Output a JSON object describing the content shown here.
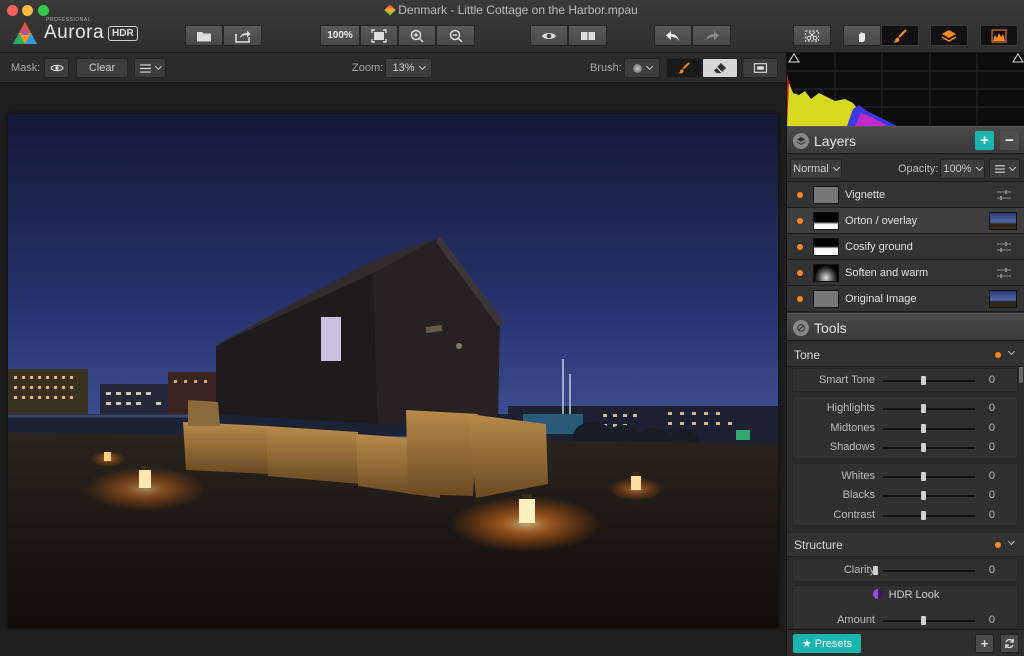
{
  "window": {
    "title": "Denmark - Little Cottage on the Harbor.mpau"
  },
  "logo": {
    "pro_label": "PROFESSIONAL",
    "name": "Aurora",
    "badge": "HDR"
  },
  "toolbar": {
    "zoom_fit_label": "100%",
    "icons": [
      "open-folder-icon",
      "share-icon",
      "fit-screen-icon",
      "zoom-in-icon",
      "zoom-out-icon",
      "eye-icon",
      "compare-icon",
      "undo-icon",
      "redo-icon",
      "crop-mask-icon",
      "hand-icon",
      "brush-icon",
      "layers-icon",
      "histogram-icon"
    ]
  },
  "subbar": {
    "mask_label": "Mask:",
    "clear_label": "Clear",
    "zoom_label": "Zoom:",
    "zoom_value": "13%",
    "brush_label": "Brush:"
  },
  "layers": {
    "title": "Layers",
    "blend_mode": "Normal",
    "opacity_label": "Opacity:",
    "opacity_value": "100%",
    "items": [
      {
        "name": "Vignette"
      },
      {
        "name": "Orton / overlay"
      },
      {
        "name": "Cosify ground"
      },
      {
        "name": "Soften and warm"
      },
      {
        "name": "Original Image"
      }
    ]
  },
  "tools": {
    "title": "Tools",
    "tone": {
      "title": "Tone",
      "smart_tone": {
        "label": "Smart Tone",
        "value": "0"
      },
      "highlights": {
        "label": "Highlights",
        "value": "0"
      },
      "midtones": {
        "label": "Midtones",
        "value": "0"
      },
      "shadows": {
        "label": "Shadows",
        "value": "0"
      },
      "whites": {
        "label": "Whites",
        "value": "0"
      },
      "blacks": {
        "label": "Blacks",
        "value": "0"
      },
      "contrast": {
        "label": "Contrast",
        "value": "0"
      }
    },
    "structure": {
      "title": "Structure",
      "clarity": {
        "label": "Clarity",
        "value": "0"
      },
      "hdr_look": "HDR Look",
      "amount": {
        "label": "Amount",
        "value": "0"
      }
    }
  },
  "bottom": {
    "presets_label": "Presets"
  },
  "colors": {
    "accent_teal": "#1bb5b0",
    "active_orange": "#ff8a1c"
  }
}
